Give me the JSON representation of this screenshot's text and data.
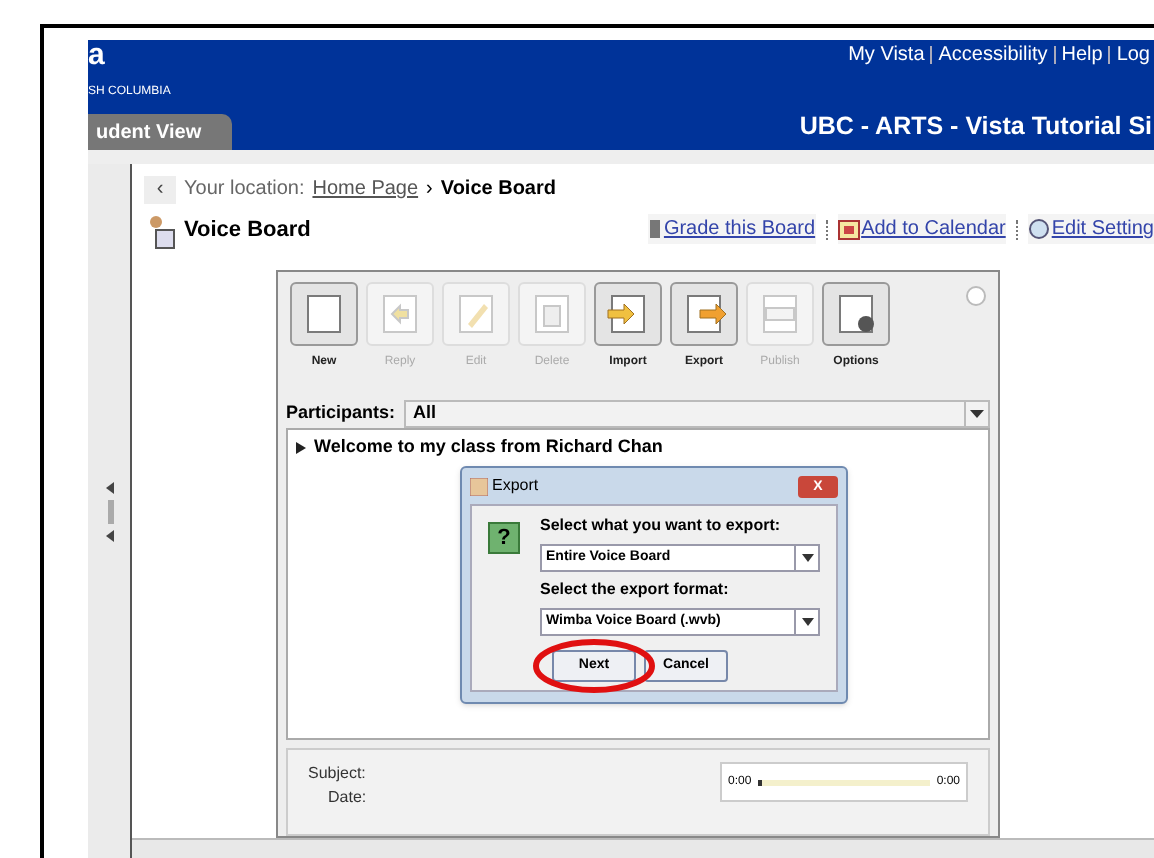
{
  "header": {
    "logo_mark": "a",
    "university": "SH COLUMBIA",
    "view_tab": "udent View",
    "site_title": "UBC - ARTS - Vista Tutorial Si",
    "top_links": [
      "My Vista",
      "Accessibility",
      "Help",
      "Log"
    ]
  },
  "breadcrumb": {
    "back": "‹",
    "prefix": "Your location:",
    "link": "Home Page",
    "separator": "›",
    "current": "Voice Board"
  },
  "page_title": "Voice Board",
  "actions": [
    {
      "label": "Grade this Board",
      "kind": "grade"
    },
    {
      "label": "Add to Calendar",
      "kind": "calendar"
    },
    {
      "label": "Edit Setting",
      "kind": "settings"
    }
  ],
  "toolbar": [
    {
      "label": "New",
      "kind": "new",
      "disabled": false
    },
    {
      "label": "Reply",
      "kind": "reply",
      "disabled": true
    },
    {
      "label": "Edit",
      "kind": "edit",
      "disabled": true
    },
    {
      "label": "Delete",
      "kind": "delete",
      "disabled": true
    },
    {
      "label": "Import",
      "kind": "import",
      "disabled": false
    },
    {
      "label": "Export",
      "kind": "export",
      "disabled": false
    },
    {
      "label": "Publish",
      "kind": "publish",
      "disabled": true
    },
    {
      "label": "Options",
      "kind": "options",
      "disabled": false
    }
  ],
  "participants": {
    "label": "Participants:",
    "value": "All"
  },
  "messages": [
    {
      "title": "Welcome to my class from Richard Chan"
    }
  ],
  "dialog": {
    "title": "Export",
    "close": "X",
    "icon_glyph": "?",
    "prompt1": "Select what you want to export:",
    "select1": "Entire Voice Board",
    "prompt2": "Select the export format:",
    "select2": "Wimba Voice Board (.wvb)",
    "buttons": [
      "Next",
      "Cancel"
    ]
  },
  "detail": {
    "labels": [
      "Subject:",
      "Date:"
    ],
    "player": {
      "start": "0:00",
      "end": "0:00",
      "level": 0.02
    }
  }
}
